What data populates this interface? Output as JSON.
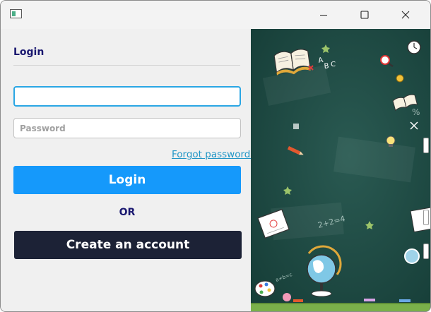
{
  "window": {
    "icon": "app-window-icon",
    "controls": {
      "minimize_icon": "minimize-icon",
      "maximize_icon": "maximize-icon",
      "close_icon": "close-icon"
    }
  },
  "login_form": {
    "heading": "Login",
    "username": {
      "value": "",
      "placeholder": ""
    },
    "password": {
      "value": "",
      "placeholder": "Password"
    },
    "forgot_password_link": "Forgot password?",
    "login_button": "Login",
    "or_label": "OR",
    "create_account_button": "Create an account"
  },
  "illustration": {
    "description_icon": "classroom-chalkboard-illustration",
    "chalk_text": [
      "2+2=4",
      "A",
      "B",
      "C",
      "%"
    ],
    "colors": {
      "chalkboard": "#1f4c45",
      "floor": "#7ab04a"
    }
  },
  "colors": {
    "heading_text": "#1a1870",
    "login_button": "#1599fb",
    "create_button": "#1c2236",
    "link": "#2196c6",
    "focus_border": "#2aa6e4"
  }
}
